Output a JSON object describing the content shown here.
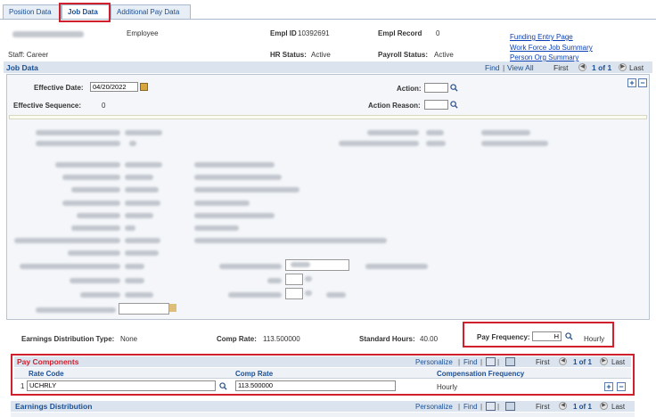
{
  "tabs": [
    {
      "label": "Position Data"
    },
    {
      "label": "Job Data"
    },
    {
      "label": "Additional Pay Data"
    }
  ],
  "header": {
    "employee_name": "",
    "employee_role": "Employee",
    "empl_id_label": "Empl ID",
    "empl_id_value": "10392691",
    "empl_record_label": "Empl Record",
    "empl_record_value": "0",
    "staff_text": "Staff: Career",
    "hr_status_label": "HR Status:",
    "hr_status_value": "Active",
    "payroll_status_label": "Payroll Status:",
    "payroll_status_value": "Active",
    "links": [
      "Funding Entry Page",
      "Work Force Job Summary",
      "Person Org Summary"
    ]
  },
  "job_data": {
    "title": "Job Data",
    "nav_find": "Find",
    "nav_sep": "|",
    "nav_view_all": "View All",
    "nav_first": "First",
    "nav_count": "1 of 1",
    "nav_last": "Last",
    "effective_date_label": "Effective Date:",
    "effective_date_value": "04/20/2022",
    "effective_sequence_label": "Effective Sequence:",
    "effective_sequence_value": "0",
    "action_label": "Action:",
    "action_value": "",
    "action_reason_label": "Action Reason:",
    "action_reason_value": ""
  },
  "summary": {
    "earnings_dist_type_label": "Earnings Distribution Type:",
    "earnings_dist_type_value": "None",
    "comp_rate_label": "Comp Rate:",
    "comp_rate_value": "113.500000",
    "standard_hours_label": "Standard Hours:",
    "standard_hours_value": "40.00",
    "pay_frequency_label": "Pay Frequency:",
    "pay_frequency_value": "H",
    "pay_frequency_desc": "Hourly"
  },
  "pay_components": {
    "title": "Pay Components",
    "nav_personalize": "Personalize",
    "nav_sep": "|",
    "nav_find": "Find",
    "nav_first": "First",
    "nav_count": "1 of 1",
    "nav_last": "Last",
    "columns": [
      "Rate Code",
      "Comp Rate",
      "Compensation Frequency"
    ],
    "rows": [
      {
        "num": "1",
        "rate_code": "UCHRLY",
        "comp_rate": "113.500000",
        "comp_frequency": "Hourly"
      }
    ]
  },
  "earnings_distribution": {
    "title": "Earnings Distribution",
    "nav_personalize": "Personalize",
    "nav_sep": "|",
    "nav_find": "Find",
    "nav_first": "First",
    "nav_count": "1 of 1",
    "nav_last": "Last"
  },
  "colors": {
    "accent_red": "#d0202e",
    "link_blue": "#0a3fb4",
    "header_blue": "#1b4f93",
    "section_bg": "#dbe4ee"
  }
}
